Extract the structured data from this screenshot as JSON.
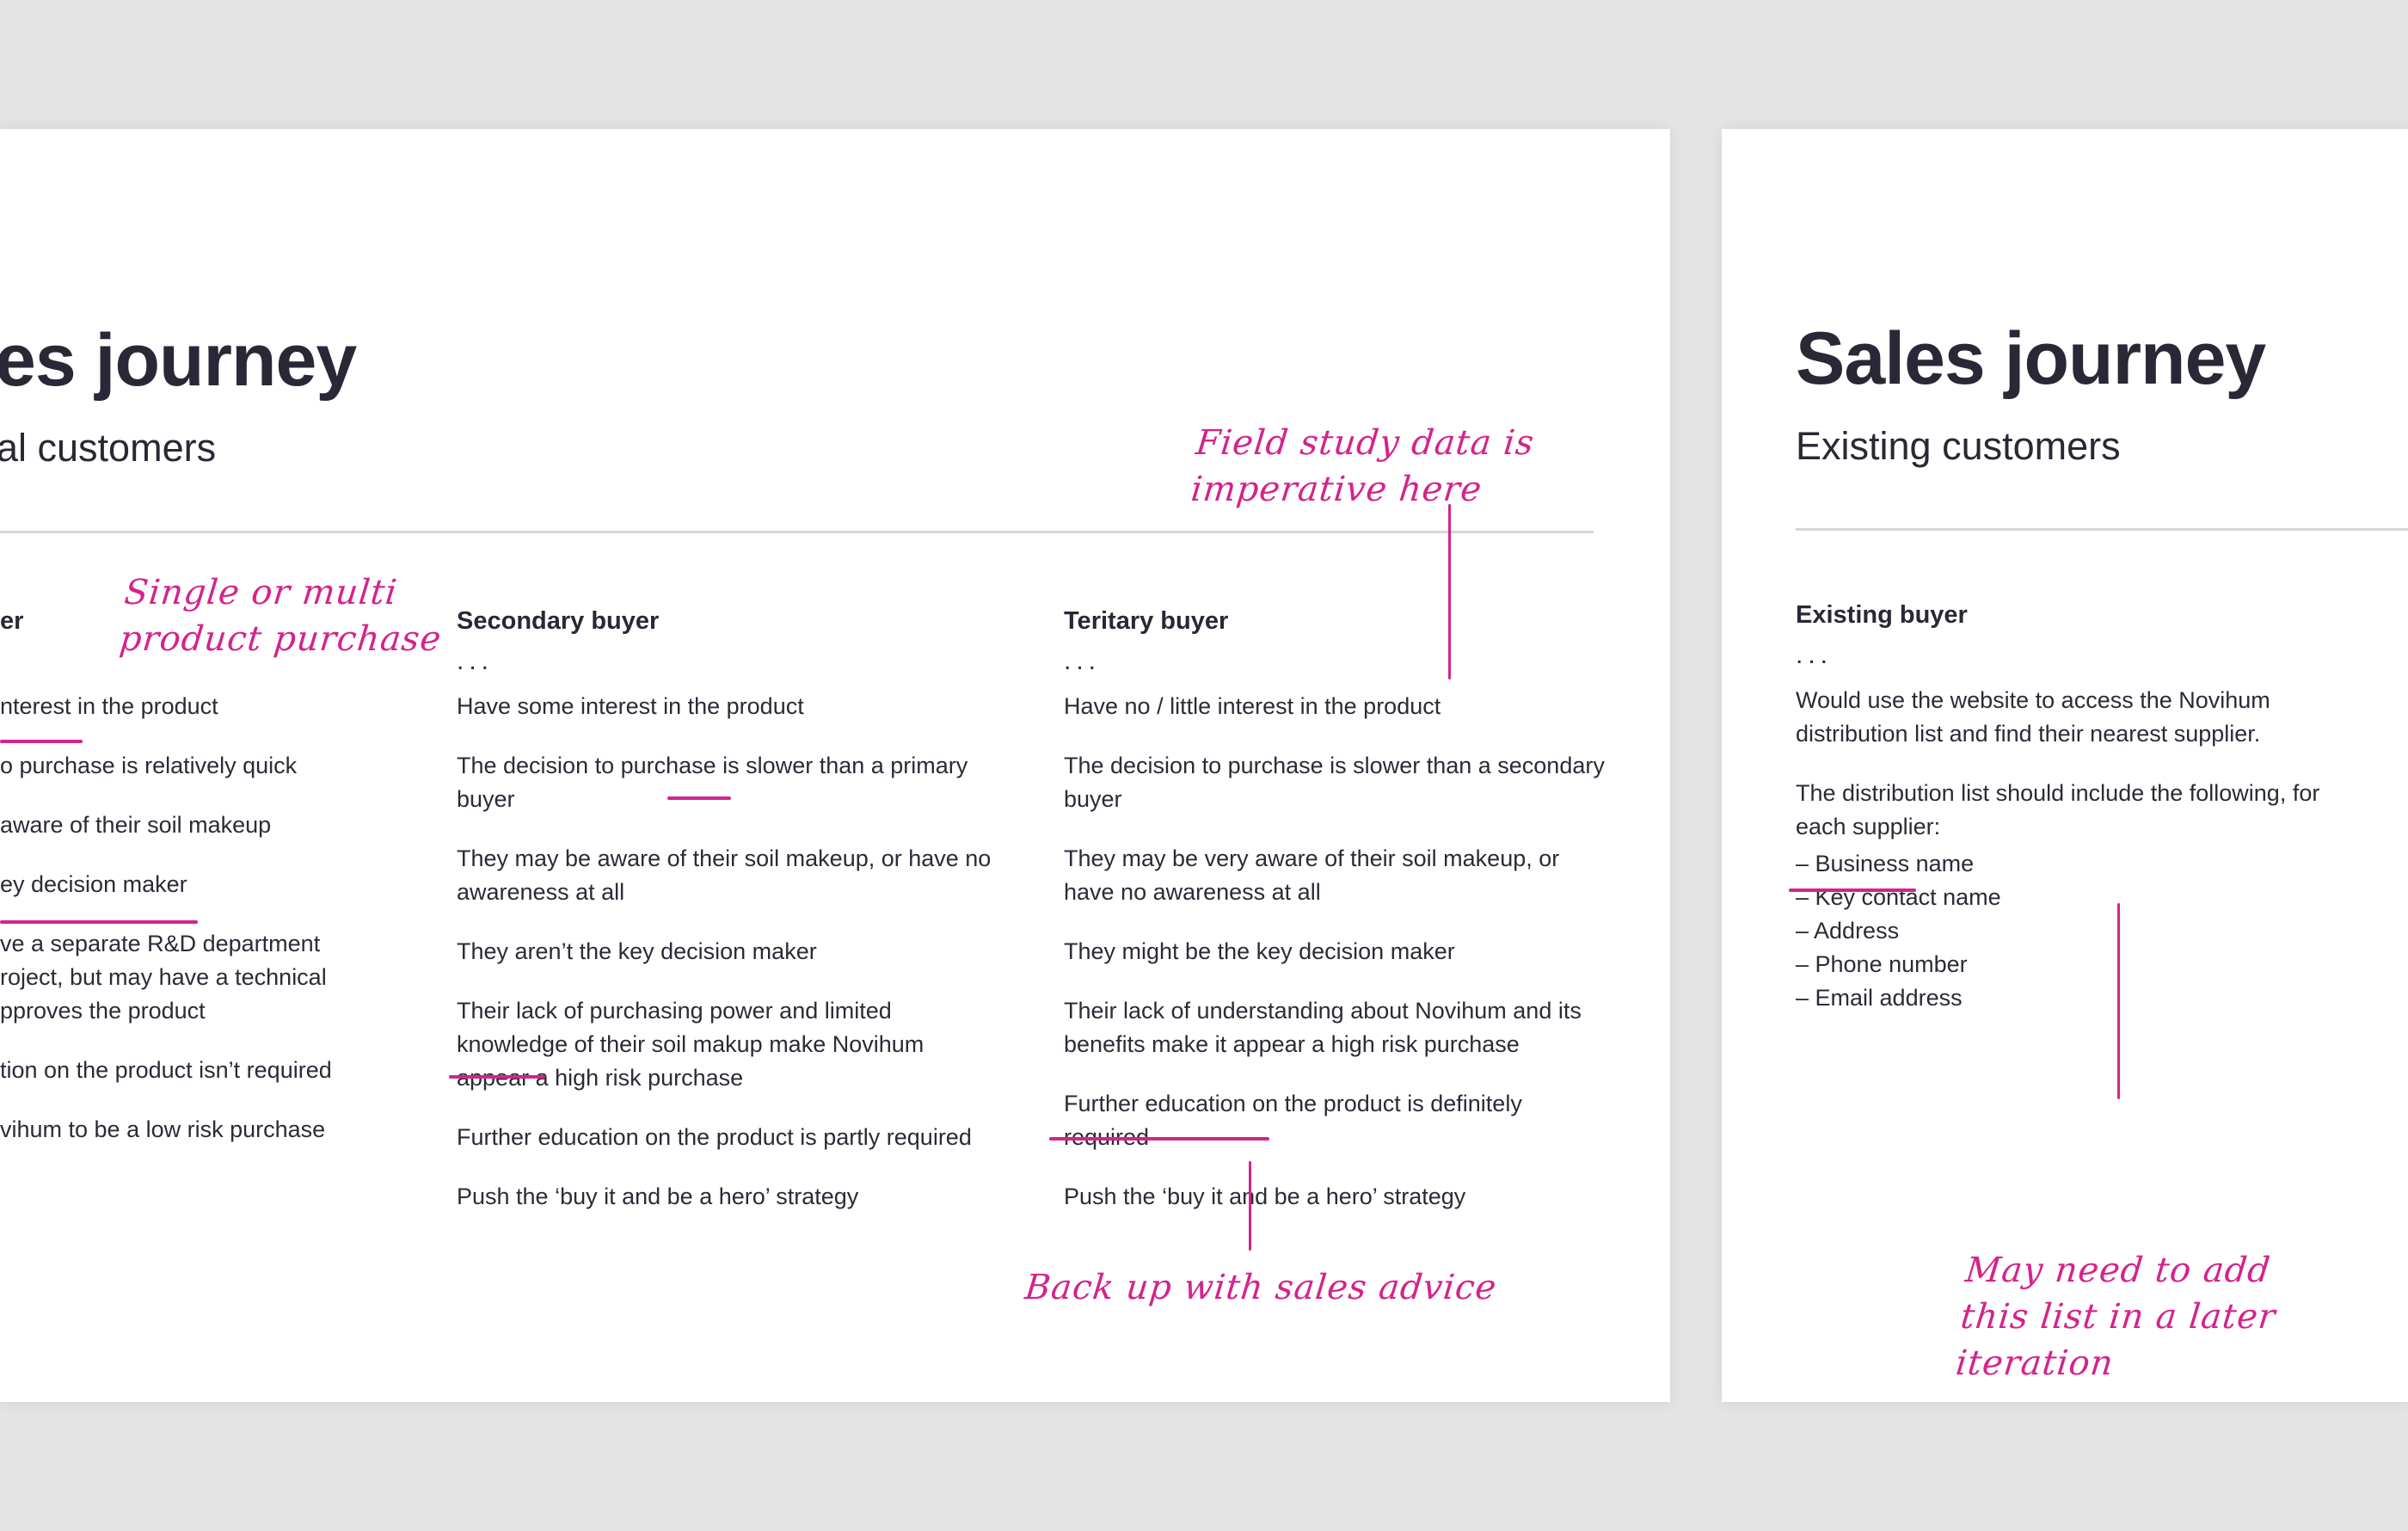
{
  "accent_color": "#d4238c",
  "slides": [
    {
      "title": "Sales journey",
      "title_visible": "es journey",
      "subtitle": "Potential customers",
      "subtitle_visible": "al customers",
      "columns": [
        {
          "heading_visible": "er",
          "heading": "Primary buyer",
          "ellipsis": "...",
          "items": [
            "nterest in the product",
            "o purchase is relatively quick",
            "aware of their soil makeup",
            "ey decision maker",
            "ve a separate R&D department",
            "roject, but may have a technical",
            "pproves the product",
            "tion on the product isn’t required",
            "vihum to be a low risk purchase"
          ]
        },
        {
          "heading": "Secondary buyer",
          "ellipsis": "...",
          "items": [
            "Have some interest in the product",
            "The decision to purchase is slower than a primary buyer",
            "They may be aware of their soil makeup, or have no awareness at all",
            "They aren’t the key decision maker",
            "Their lack of purchasing power and limited knowledge of their soil makup make Novihum appear a high risk purchase",
            "Further education on the product is partly required",
            "Push the ‘buy it and be a hero’ strategy"
          ]
        },
        {
          "heading": "Teritary buyer",
          "ellipsis": "...",
          "items": [
            "Have no / little interest in the product",
            "The decision to purchase is slower than a secondary buyer",
            "They may be very aware of their soil makeup, or have no awareness at all",
            "They might be the key decision maker",
            "Their lack of understanding about Novihum and its benefits make it appear a high risk purchase",
            "Further education on the product is definitely required",
            "Push the ‘buy it and be a hero’ strategy"
          ]
        }
      ],
      "annotations": [
        "Single or multi\nproduct purchase",
        "Field study data is\nimperative here",
        "Back up with sales advice"
      ]
    },
    {
      "title": "Sales journey",
      "subtitle": "Existing customers",
      "column": {
        "heading": "Existing buyer",
        "ellipsis": "...",
        "paragraphs": [
          "Would use the website to access the Novihum distribution list and find their nearest supplier.",
          "The distribution list should include the following, for each supplier:"
        ],
        "list": [
          "– Business name",
          "– Key contact name",
          "– Address",
          "– Phone number",
          "– Email address"
        ]
      },
      "annotations": [
        "May need to add\nthis list in a later\niteration"
      ]
    }
  ]
}
